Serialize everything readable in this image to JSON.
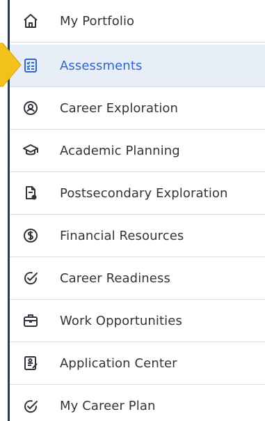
{
  "menu": {
    "items": [
      {
        "label": "My Portfolio",
        "icon": "home-icon",
        "active": false
      },
      {
        "label": "Assessments",
        "icon": "checklist-icon",
        "active": true
      },
      {
        "label": "Career Exploration",
        "icon": "person-circle-icon",
        "active": false
      },
      {
        "label": "Academic Planning",
        "icon": "graduation-cap-icon",
        "active": false
      },
      {
        "label": "Postsecondary Exploration",
        "icon": "document-pin-icon",
        "active": false
      },
      {
        "label": "Financial Resources",
        "icon": "dollar-circle-icon",
        "active": false
      },
      {
        "label": "Career Readiness",
        "icon": "checkmark-circle-icon",
        "active": false
      },
      {
        "label": "Work Opportunities",
        "icon": "briefcase-icon",
        "active": false
      },
      {
        "label": "Application Center",
        "icon": "application-form-icon",
        "active": false
      },
      {
        "label": "My Career Plan",
        "icon": "checkmark-circle-icon",
        "active": false
      }
    ]
  },
  "colors": {
    "active_background": "#e8eef8",
    "active_text": "#2f65c8",
    "text": "#2f343a",
    "left_border": "#243a63",
    "divider": "#d7dce3",
    "pointer_arrow": "#f2c21b"
  }
}
